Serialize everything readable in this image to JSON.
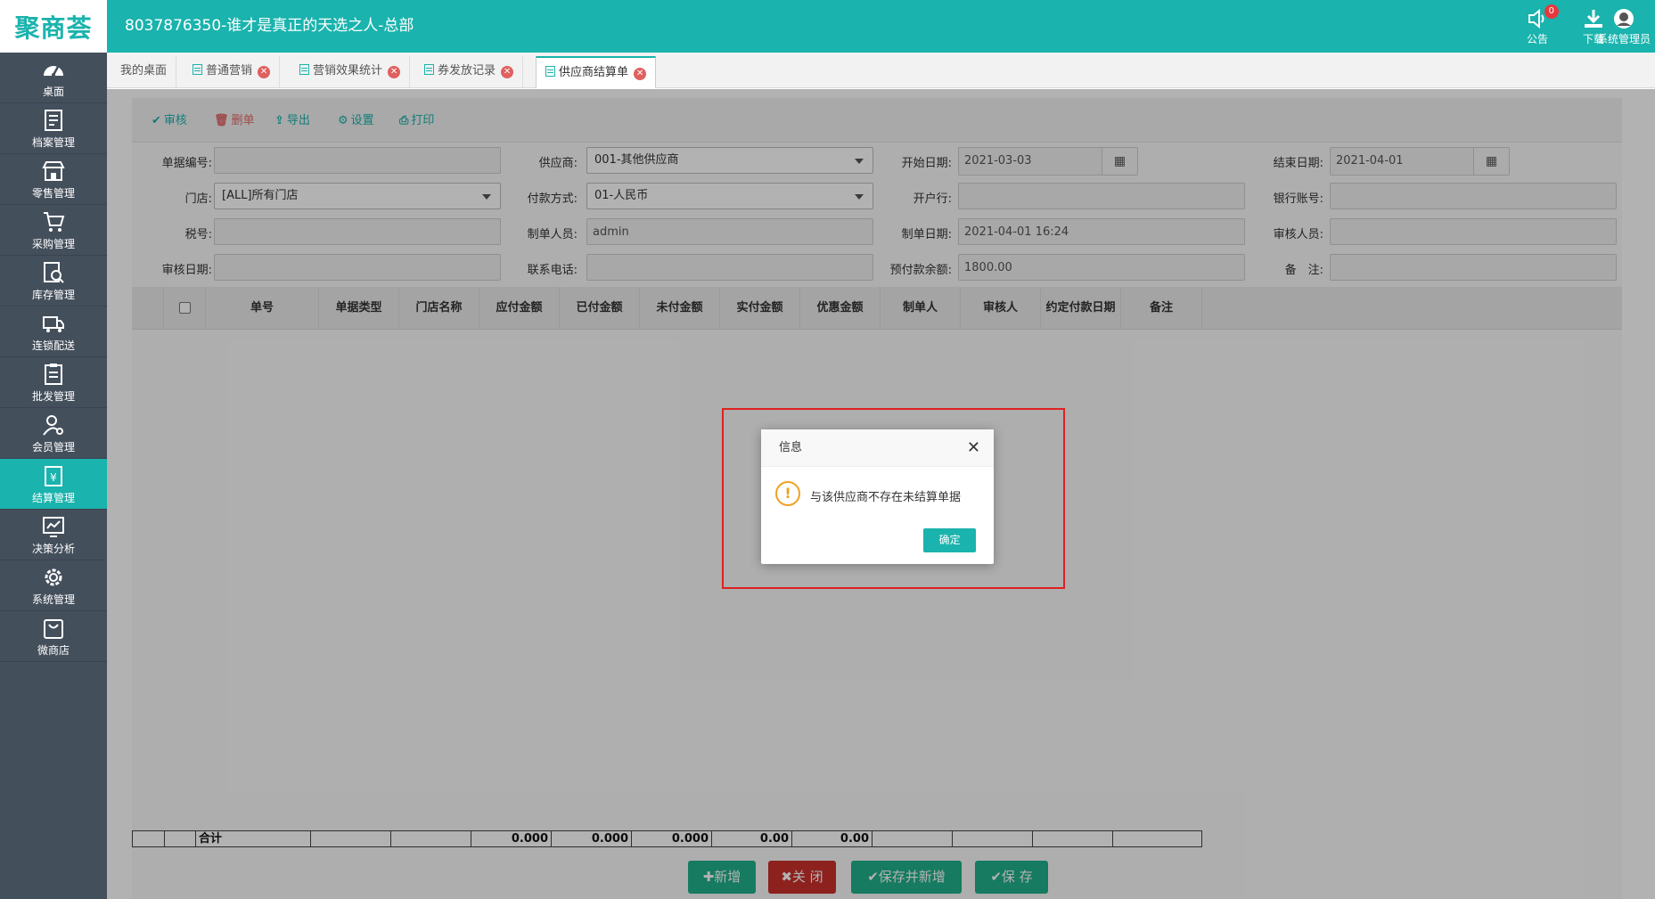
{
  "app": {
    "logo_text": "聚商荟",
    "title": "8037876350-谁才是真正的天选之人-总部"
  },
  "header_actions": [
    {
      "label": "公告",
      "icon": "speaker-icon",
      "badge": "0"
    },
    {
      "label": "下载",
      "icon": "download-icon"
    },
    {
      "label": "系统管理员",
      "icon": "avatar-icon"
    }
  ],
  "sidebar": {
    "items": [
      {
        "label": "桌面",
        "icon": "dashboard-icon"
      },
      {
        "label": "档案管理",
        "icon": "archive-icon"
      },
      {
        "label": "零售管理",
        "icon": "store-icon"
      },
      {
        "label": "采购管理",
        "icon": "cart-icon"
      },
      {
        "label": "库存管理",
        "icon": "inventory-icon"
      },
      {
        "label": "连锁配送",
        "icon": "truck-icon"
      },
      {
        "label": "批发管理",
        "icon": "wholesale-icon"
      },
      {
        "label": "会员管理",
        "icon": "member-icon"
      },
      {
        "label": "结算管理",
        "icon": "settlement-icon",
        "active": true
      },
      {
        "label": "决策分析",
        "icon": "chart-icon"
      },
      {
        "label": "系统管理",
        "icon": "gear-icon"
      },
      {
        "label": "微商店",
        "icon": "shop-bag-icon"
      }
    ]
  },
  "tabs": [
    {
      "label": "我的桌面"
    },
    {
      "label": "普通营销"
    },
    {
      "label": "营销效果统计"
    },
    {
      "label": "券发放记录"
    },
    {
      "label": "供应商结算单",
      "active": true
    }
  ],
  "toolbar": {
    "approve": "审核",
    "delete": "删单",
    "export": "导出",
    "settings": "设置",
    "print": "打印"
  },
  "form": {
    "doc_no": {
      "label": "单据编号:",
      "value": ""
    },
    "supplier": {
      "label": "供应商:",
      "value": "001-其他供应商"
    },
    "start_date": {
      "label": "开始日期:",
      "value": "2021-03-03"
    },
    "end_date": {
      "label": "结束日期:",
      "value": "2021-04-01"
    },
    "store": {
      "label": "门店:",
      "value": "[ALL]所有门店"
    },
    "pay_method": {
      "label": "付款方式:",
      "value": "01-人民币"
    },
    "bank": {
      "label": "开户行:",
      "value": ""
    },
    "bank_account": {
      "label": "银行账号:",
      "value": ""
    },
    "tax_no": {
      "label": "税号:",
      "value": ""
    },
    "creator": {
      "label": "制单人员:",
      "value": "admin"
    },
    "create_date": {
      "label": "制单日期:",
      "value": "2021-04-01 16:24"
    },
    "approver": {
      "label": "审核人员:",
      "value": ""
    },
    "approve_date": {
      "label": "审核日期:",
      "value": ""
    },
    "phone": {
      "label": "联系电话:",
      "value": ""
    },
    "prepaid_balance": {
      "label": "预付款余额:",
      "value": "1800.00"
    },
    "remark": {
      "label": "备　注:",
      "value": ""
    }
  },
  "grid": {
    "columns": [
      "单号",
      "单据类型",
      "门店名称",
      "应付金额",
      "已付金额",
      "未付金额",
      "实付金额",
      "优惠金额",
      "制单人",
      "审核人",
      "约定付款日期",
      "备注"
    ],
    "footer": {
      "label": "合计",
      "payable": "0.000",
      "paid": "0.000",
      "unpaid": "0.000",
      "actual_paid": "0.00",
      "discount": "0.00"
    }
  },
  "bottom_buttons": {
    "add": "新增",
    "close": "关 闭",
    "save_new": "保存并新增",
    "save": "保 存"
  },
  "dialog": {
    "title": "信息",
    "message": "与该供应商不存在未结算单据",
    "ok": "确定"
  },
  "colors": {
    "primary": "#1ab3ad",
    "sidebar": "#444f5c",
    "danger": "#c9302c",
    "highlight": "#e02020"
  }
}
